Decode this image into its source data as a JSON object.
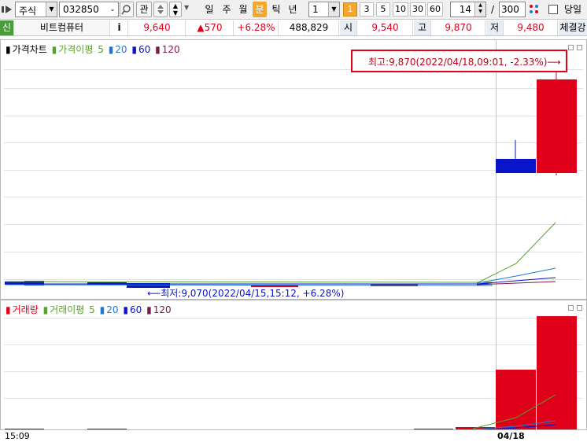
{
  "toolbar": {
    "market_type": "주식",
    "stock_code": "032850",
    "interest_label": "관",
    "periods": [
      "일",
      "주",
      "월",
      "분",
      "틱",
      "년"
    ],
    "active_period": "분",
    "interval_value": "1",
    "minute_options": [
      "1",
      "3",
      "5",
      "10",
      "30",
      "60"
    ],
    "active_minute": "1",
    "count_value": "14",
    "count_sep": "/",
    "total_value": "300",
    "today_label": "당일"
  },
  "quote": {
    "market_badge": "신",
    "stock_name": "비트컴퓨터",
    "info_label": "i",
    "price": "9,640",
    "change": "▲570",
    "change_rate": "+6.28%",
    "volume": "488,829",
    "open_label": "시",
    "open": "9,540",
    "high_label": "고",
    "high": "9,870",
    "low_label": "저",
    "low": "9,480",
    "exec_label": "체결강"
  },
  "price_chart": {
    "legend": {
      "title": "가격차트",
      "ma_title": "가격이평",
      "ma_periods": [
        "5",
        "20",
        "60",
        "120"
      ]
    },
    "high_annotation": "최고:9,870(2022/04/18,09:01, -2.33%)⟶",
    "low_annotation": "⟵최저:9,070(2022/04/15,15:12, +6.28%)"
  },
  "volume_chart": {
    "legend": {
      "title": "거래량",
      "ma_title": "거래이평",
      "ma_periods": [
        "5",
        "20",
        "60",
        "120"
      ]
    }
  },
  "x_axis": {
    "left_label": "15:09",
    "date_label": "04/18"
  },
  "colors": {
    "up": "#e0001a",
    "down": "#0a14c8",
    "ma5": "#5aa02c",
    "ma20": "#1f7ad6",
    "ma60": "#0a14c8",
    "ma120": "#7a1a4a",
    "accent": "#f3a72d"
  }
}
